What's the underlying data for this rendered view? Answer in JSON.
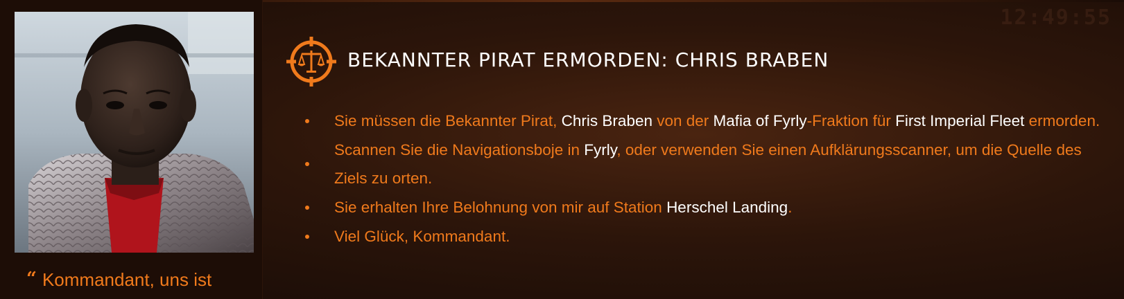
{
  "clock": "12:49:55",
  "colors": {
    "accent": "#f07a1c",
    "highlight": "#ffffff",
    "background": "#2c150a"
  },
  "contact": {
    "portrait_icon": "contact-portrait",
    "quote_icon": "quote-mark",
    "quote_text": "Kommandant, uns ist"
  },
  "mission": {
    "icon": "assassination-target-icon",
    "title": "BEKANNTER PIRAT ERMORDEN: CHRIS BRABEN",
    "briefing": [
      {
        "parts": [
          "Sie müssen die Bekannter Pirat, ",
          "Chris Braben",
          " von der ",
          "Mafia of Fyrly",
          "-Fraktion für ",
          "First Imperial Fleet",
          " ermorden."
        ]
      },
      {
        "parts": [
          "Scannen Sie die Navigationsboje in ",
          "Fyrly",
          ", oder verwenden Sie einen Aufklärungsscanner, um die Quelle des Ziels zu orten."
        ]
      },
      {
        "parts": [
          "Sie erhalten Ihre Belohnung von mir auf Station ",
          "Herschel Landing",
          "."
        ]
      },
      {
        "parts": [
          "Viel Glück, Kommandant."
        ]
      }
    ]
  }
}
